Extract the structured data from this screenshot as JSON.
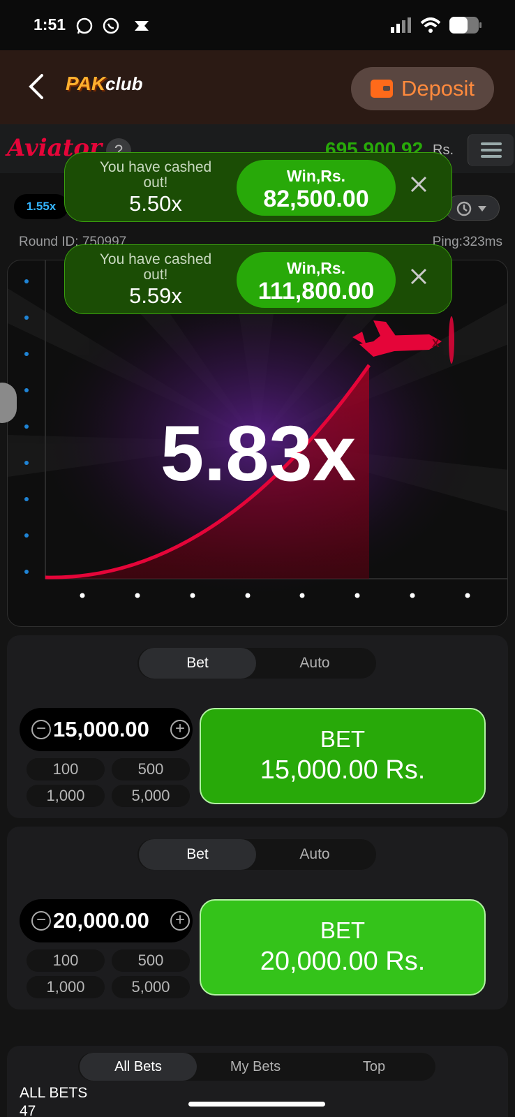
{
  "status_bar": {
    "time": "1:51"
  },
  "topbar": {
    "logo_pak": "PAK",
    "logo_club": "club",
    "deposit_label": "Deposit"
  },
  "aviator_header": {
    "logo": "Aviator",
    "help": "?",
    "balance": "695,900.92",
    "currency": "Rs."
  },
  "history": {
    "first_multiplier": "1.55x"
  },
  "round": {
    "round_id": "Round ID: 750997",
    "ping": "Ping:323ms"
  },
  "game": {
    "multiplier": "5.83x",
    "curve_color": "#e50539"
  },
  "toasts": [
    {
      "message": "You have cashed out!",
      "multiplier": "5.50x",
      "win_label": "Win,Rs.",
      "win_amount": "82,500.00"
    },
    {
      "message": "You have cashed out!",
      "multiplier": "5.59x",
      "win_label": "Win,Rs.",
      "win_amount": "111,800.00"
    }
  ],
  "bet_panels": [
    {
      "tab_bet": "Bet",
      "tab_auto": "Auto",
      "stake": "15,000.00",
      "quick_amounts": [
        "100",
        "500",
        "1,000",
        "5,000"
      ],
      "button_line1": "BET",
      "button_line2": "15,000.00 Rs.",
      "button_color": "#28a909"
    },
    {
      "tab_bet": "Bet",
      "tab_auto": "Auto",
      "stake": "20,000.00",
      "quick_amounts": [
        "100",
        "500",
        "1,000",
        "5,000"
      ],
      "button_line1": "BET",
      "button_line2": "20,000.00 Rs.",
      "button_color": "#34c31a"
    }
  ],
  "all_bets": {
    "tabs": [
      "All Bets",
      "My Bets",
      "Top"
    ],
    "title": "ALL BETS",
    "count": "47"
  },
  "colors": {
    "accent_green": "#28a909",
    "aviator_red": "#e50539",
    "deposit_orange": "#ff8a3d"
  }
}
